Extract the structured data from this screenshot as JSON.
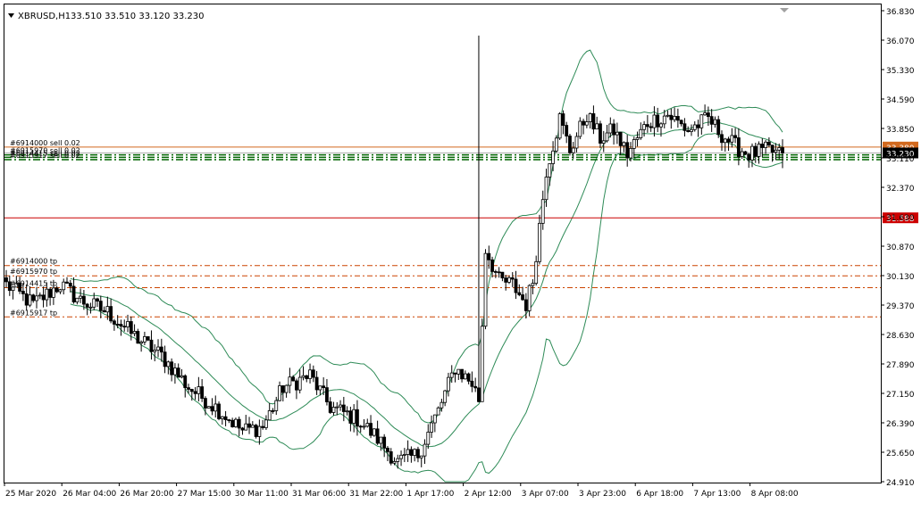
{
  "header": {
    "symbol_label": "XBRUSD,H1",
    "ohlc": "33.510 33.510 33.120 33.230"
  },
  "colors": {
    "background": "#ffffff",
    "axis": "#000000",
    "candle": "#000000",
    "bands": "#2e8b57",
    "sell_line": "#d2691e",
    "stop_line": "#cc0000",
    "tp_line": "#cc4400",
    "level_green": "#006400",
    "price_label_bg": "#000000",
    "price_label_text": "#ffffff",
    "stop_label_bg": "#cc0000"
  },
  "chart_data": {
    "type": "candlestick",
    "y_ticks": [
      "36.830",
      "36.070",
      "35.330",
      "34.590",
      "33.850",
      "33.110",
      "32.370",
      "31.630",
      "30.870",
      "30.130",
      "29.370",
      "28.630",
      "27.890",
      "27.150",
      "26.390",
      "25.650",
      "24.910"
    ],
    "x_ticks": [
      "25 Mar 2020",
      "26 Mar 04:00",
      "26 Mar 20:00",
      "27 Mar 15:00",
      "30 Mar 11:00",
      "31 Mar 06:00",
      "31 Mar 22:00",
      "1 Apr 17:00",
      "2 Apr 12:00",
      "3 Apr 07:00",
      "3 Apr 23:00",
      "6 Apr 18:00",
      "7 Apr 13:00",
      "8 Apr 08:00"
    ],
    "ylim": [
      24.91,
      36.83
    ],
    "current_price": "33.230",
    "current_price_value": 33.23,
    "order_lines": [
      {
        "label": "#6914000 sell 0.02",
        "price_label": "33.380",
        "value": 33.38,
        "kind": "sell"
      },
      {
        "label": "#6915970 sell 0.02",
        "value": 33.18,
        "kind": "order_green"
      },
      {
        "label": "#6914415 sell 0.02",
        "value": 33.12,
        "kind": "order_green"
      },
      {
        "label": "#6915917 sell 0.02",
        "value": 33.06,
        "kind": "order_green"
      },
      {
        "label": "",
        "price_label": "31.588",
        "value": 31.588,
        "kind": "stop"
      },
      {
        "label": "#6914000 tp",
        "value": 30.38,
        "kind": "tp"
      },
      {
        "label": "#6915970 tp",
        "value": 30.12,
        "kind": "tp"
      },
      {
        "label": "#6914415 tp",
        "value": 29.82,
        "kind": "tp"
      },
      {
        "label": "#6915917 tp",
        "value": 29.08,
        "kind": "tp"
      }
    ],
    "anchors": [
      [
        0,
        29.9
      ],
      [
        8,
        29.4
      ],
      [
        16,
        29.9
      ],
      [
        22,
        29.5
      ],
      [
        30,
        29.2
      ],
      [
        38,
        28.6
      ],
      [
        46,
        28.1
      ],
      [
        54,
        27.3
      ],
      [
        62,
        26.8
      ],
      [
        70,
        26.2
      ],
      [
        76,
        26.3
      ],
      [
        82,
        27.3
      ],
      [
        90,
        27.6
      ],
      [
        96,
        26.8
      ],
      [
        104,
        26.5
      ],
      [
        110,
        26.0
      ],
      [
        116,
        25.4
      ],
      [
        122,
        25.6
      ],
      [
        128,
        26.7
      ],
      [
        133,
        27.8
      ],
      [
        138,
        27.4
      ],
      [
        140,
        27.0
      ],
      [
        142,
        30.8
      ],
      [
        146,
        30.0
      ],
      [
        150,
        29.9
      ],
      [
        154,
        29.4
      ],
      [
        156,
        30.0
      ],
      [
        160,
        32.8
      ],
      [
        164,
        34.1
      ],
      [
        167,
        33.3
      ],
      [
        172,
        34.2
      ],
      [
        176,
        33.6
      ],
      [
        180,
        33.8
      ],
      [
        184,
        33.2
      ],
      [
        190,
        34.0
      ],
      [
        196,
        34.2
      ],
      [
        202,
        33.8
      ],
      [
        208,
        34.1
      ],
      [
        212,
        33.7
      ],
      [
        216,
        33.4
      ],
      [
        220,
        33.2
      ],
      [
        226,
        33.3
      ],
      [
        230,
        33.15
      ]
    ]
  }
}
